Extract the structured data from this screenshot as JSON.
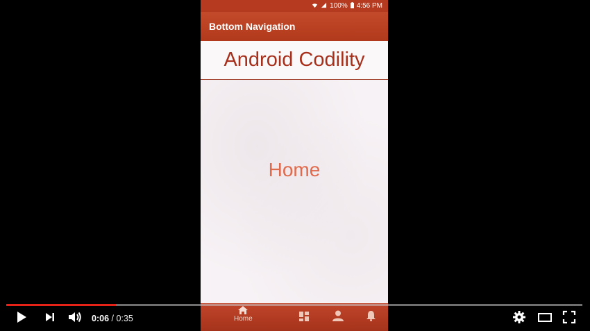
{
  "status_bar": {
    "battery": "100%",
    "time": "4:56 PM"
  },
  "app": {
    "title": "Bottom Navigation",
    "brand": "Android Codility",
    "page_label": "Home"
  },
  "bottom_nav": {
    "items": [
      {
        "label": "Home",
        "icon": "home-icon",
        "active": true
      },
      {
        "label": "",
        "icon": "dashboard-icon",
        "active": false
      },
      {
        "label": "",
        "icon": "person-icon",
        "active": false
      },
      {
        "label": "",
        "icon": "bell-icon",
        "active": false
      }
    ]
  },
  "player": {
    "current_time": "0:06",
    "separator": " / ",
    "duration": "0:35",
    "progress": 0.19,
    "accent_color": "#e62117"
  }
}
